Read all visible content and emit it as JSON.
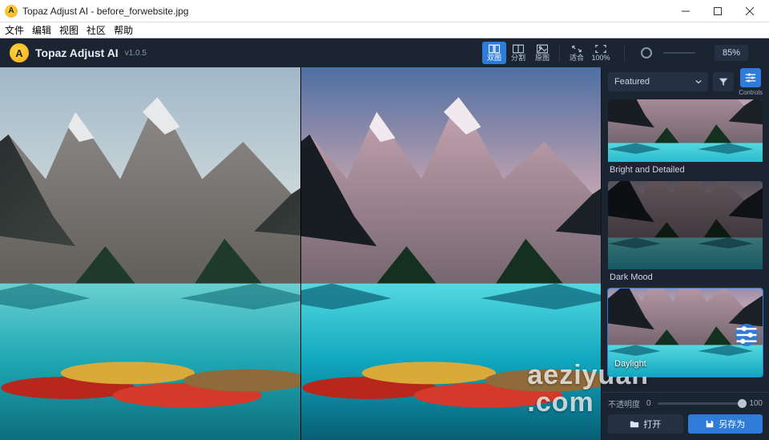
{
  "window": {
    "title": "Topaz Adjust AI - before_forwebsite.jpg"
  },
  "menu": {
    "items": [
      "文件",
      "编辑",
      "视图",
      "社区",
      "帮助"
    ]
  },
  "brand": {
    "name": "Topaz Adjust AI",
    "version": "v1.0.5"
  },
  "viewmodes": {
    "dual": {
      "label": "双图",
      "active": true
    },
    "split": {
      "label": "分割",
      "active": false
    },
    "single": {
      "label": "原图",
      "active": false
    },
    "fit": {
      "label": "适合",
      "active": false
    },
    "hundred": {
      "label": "100%",
      "active": false
    }
  },
  "zoom": {
    "value": "85%"
  },
  "sidepanel": {
    "dropdown": {
      "label": "Featured"
    },
    "controls_label": "Controls",
    "presets": [
      {
        "label": "Bright and Detailed",
        "selected": false
      },
      {
        "label": "Dark Mood",
        "selected": false
      },
      {
        "label": "Daylight",
        "selected": true
      }
    ],
    "opacity": {
      "label": "不透明度",
      "min": "0",
      "max": "100"
    },
    "buttons": {
      "open": "打开",
      "saveas": "另存为"
    }
  },
  "watermark": {
    "line1": "aeziyuan",
    "line2": ".com"
  }
}
